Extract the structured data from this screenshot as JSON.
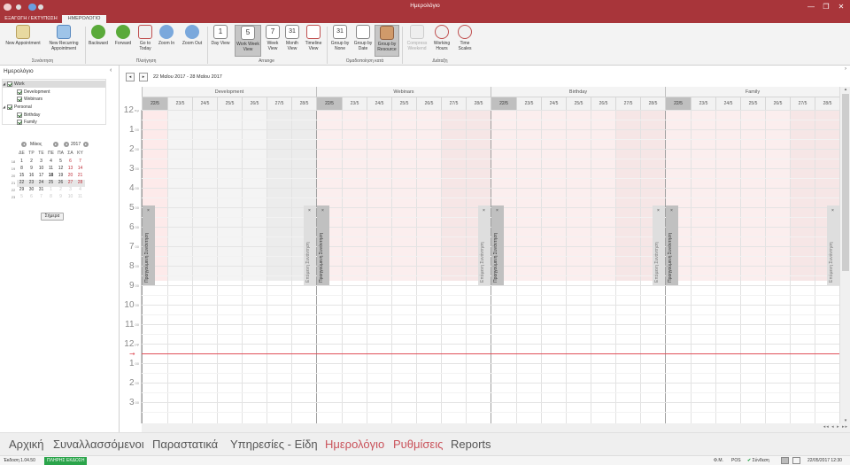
{
  "window": {
    "title": "Ημερολόγιο",
    "min": "—",
    "max": "❐",
    "close": "✕"
  },
  "tabs": [
    {
      "label": "ΕΞΑΓΩΓΗ / ΕΚΤΥΠΩΣΗ"
    },
    {
      "label": "ΗΜΕΡΟΛΟΓΙΟ"
    }
  ],
  "ribbon": {
    "buttons": [
      {
        "label": "New Appointment",
        "icon": "new-appointment-icon"
      },
      {
        "label": "New Recurring Appointment",
        "icon": "new-recurring-appointment-icon"
      },
      {
        "label": "Backward",
        "icon": "backward-icon"
      },
      {
        "label": "Forward",
        "icon": "forward-icon"
      },
      {
        "label": "Go to Today",
        "icon": "today-icon"
      },
      {
        "label": "Zoom In",
        "icon": "zoom-in-icon"
      },
      {
        "label": "Zoom Out",
        "icon": "zoom-out-icon"
      },
      {
        "label": "Day View",
        "icon": "day-view-icon",
        "glyph": "1"
      },
      {
        "label": "Work Week View",
        "icon": "work-week-view-icon",
        "glyph": "5"
      },
      {
        "label": "Week View",
        "icon": "week-view-icon",
        "glyph": "7"
      },
      {
        "label": "Month View",
        "icon": "month-view-icon",
        "glyph": "31"
      },
      {
        "label": "Timeline View",
        "icon": "timeline-view-icon"
      },
      {
        "label": "Group by None",
        "icon": "group-none-icon",
        "glyph": "31"
      },
      {
        "label": "Group by Date",
        "icon": "group-date-icon"
      },
      {
        "label": "Group by Resource",
        "icon": "group-resource-icon"
      },
      {
        "label": "Compress Weekend",
        "icon": "compress-weekend-icon"
      },
      {
        "label": "Working Hours",
        "icon": "working-hours-icon"
      },
      {
        "label": "Time Scales",
        "icon": "time-scales-icon"
      }
    ],
    "groups": [
      "Συνάντηση",
      "Πλοήγηση",
      "Arrange",
      "Ομαδοποίηση κατά",
      "Διάταξη"
    ]
  },
  "left_panel": {
    "title": "Ημερολόγιο",
    "collapse": "‹",
    "tree": [
      {
        "label": "Work",
        "toggle": "◢"
      },
      {
        "label": "Development"
      },
      {
        "label": "Webinars"
      },
      {
        "label": "Personal",
        "toggle": "◢"
      },
      {
        "label": "Birthday"
      },
      {
        "label": "Family"
      }
    ],
    "mini_calendar": {
      "month": "Μάιος",
      "year": "2017",
      "prev": "◂",
      "next": "▸",
      "weekdays": [
        "ΔΕ",
        "ΤΡ",
        "ΤΕ",
        "ΠΕ",
        "ΠΑ",
        "ΣΑ",
        "ΚΥ"
      ],
      "weeks": [
        {
          "wk": "18",
          "days": [
            "1",
            "2",
            "3",
            "4",
            "5",
            "6",
            "7"
          ]
        },
        {
          "wk": "19",
          "days": [
            "8",
            "9",
            "10",
            "11",
            "12",
            "13",
            "14"
          ]
        },
        {
          "wk": "20",
          "days": [
            "15",
            "16",
            "17",
            "18",
            "19",
            "20",
            "21"
          ]
        },
        {
          "wk": "21",
          "days": [
            "22",
            "23",
            "24",
            "25",
            "26",
            "27",
            "28"
          ]
        },
        {
          "wk": "22",
          "days": [
            "29",
            "30",
            "31",
            "1",
            "2",
            "3",
            "4"
          ]
        },
        {
          "wk": "23",
          "days": [
            "5",
            "6",
            "7",
            "8",
            "9",
            "10",
            "11"
          ]
        }
      ],
      "today_button": "Σήμερα"
    }
  },
  "scheduler": {
    "date_range": "22 Μαΐου 2017 - 28 Μαΐου 2017",
    "nav_prev": "◂",
    "nav_next": "▸",
    "collapse": "›",
    "groups": [
      "Development",
      "Webinars",
      "Birthday",
      "Family"
    ],
    "days": [
      "22/5",
      "23/5",
      "24/5",
      "25/5",
      "26/5",
      "27/5",
      "28/5"
    ],
    "hours": [
      {
        "h": "12",
        "m": "πμ"
      },
      {
        "h": "1",
        "m": "00"
      },
      {
        "h": "2",
        "m": "00"
      },
      {
        "h": "3",
        "m": "00"
      },
      {
        "h": "4",
        "m": "00"
      },
      {
        "h": "5",
        "m": "00"
      },
      {
        "h": "6",
        "m": "00"
      },
      {
        "h": "7",
        "m": "00"
      },
      {
        "h": "8",
        "m": "00"
      },
      {
        "h": "9",
        "m": "00"
      },
      {
        "h": "10",
        "m": "00"
      },
      {
        "h": "11",
        "m": "00"
      },
      {
        "h": "12",
        "m": "μμ"
      },
      {
        "h": "1",
        "m": "00"
      },
      {
        "h": "2",
        "m": "00"
      },
      {
        "h": "3",
        "m": "00"
      }
    ],
    "appointment_texts": [
      "Προηγούμενη Συνάντηση",
      "Επόμενη Συνάντηση"
    ],
    "close_glyph": "×",
    "now_arrow": "➞",
    "hscroll_nav": "◂◂ ◂ ▸ ▸▸",
    "vscroll_up": "▴",
    "vscroll_down": "▾"
  },
  "bottom_nav": [
    {
      "label": "Αρχική",
      "active": false
    },
    {
      "label": "Συναλλασσόμενοι",
      "active": false
    },
    {
      "label": "Παραστατικά",
      "active": false
    },
    {
      "label": "Υπηρεσίες - Είδη",
      "active": false
    },
    {
      "label": "Ημερολόγιο",
      "active": true
    },
    {
      "label": "Ρυθμίσεις",
      "active": true
    },
    {
      "label": "Reports",
      "active": false
    }
  ],
  "status": {
    "version": "Έκδοση 1.04.50",
    "edition": "ΠΛΗΡΗΣ ΕΚΔΟΣΗ",
    "fm": "Φ.Μ.",
    "pos": "POS",
    "connection": "Σύνδεση",
    "datetime": "22/05/2017 12:30"
  },
  "colors": {
    "brand": "#a8353a",
    "nav_active": "#c9525a",
    "edition_badge": "#2aa44a",
    "now_line": "#e0505a"
  }
}
